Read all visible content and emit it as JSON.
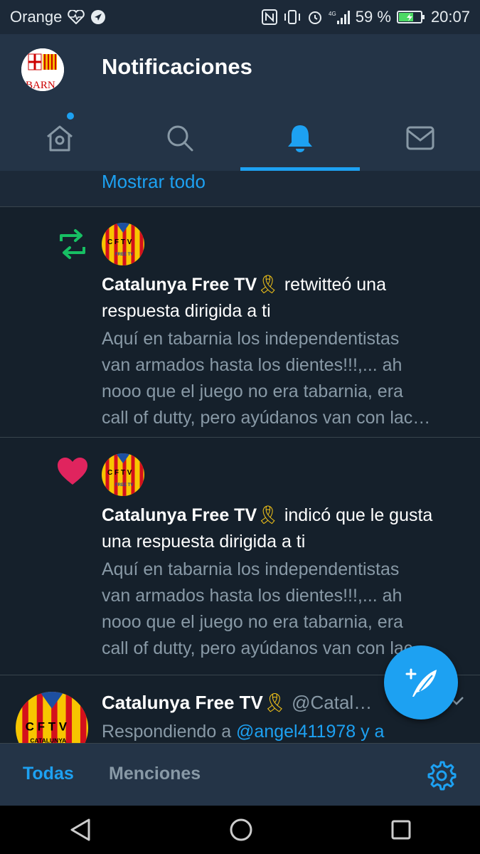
{
  "status": {
    "carrier": "Orange",
    "battery": "59 %",
    "time": "20:07"
  },
  "header": {
    "title": "Notificaciones",
    "avatar_text": "BARN"
  },
  "tabs": [
    {
      "name": "home",
      "active": false,
      "badge": true
    },
    {
      "name": "search",
      "active": false
    },
    {
      "name": "notifications",
      "active": true
    },
    {
      "name": "messages",
      "active": false
    }
  ],
  "show_all": "Mostrar todo",
  "notifications": [
    {
      "type": "retweet",
      "user": "Catalunya Free TV",
      "ribbon": "🎗",
      "action_line1": " retwitteó una",
      "action_line2": "respuesta dirigida a ti",
      "snippet": [
        "Aquí en tabarnia los independentistas",
        "van armados hasta los dientes!!!,... ah",
        "nooo que el juego no era tabarnia, era",
        "call of dutty, pero ayúdanos van con lac…"
      ],
      "avatar_text": "C F T V",
      "avatar_sub": "FREE TV"
    },
    {
      "type": "like",
      "user": "Catalunya Free TV",
      "ribbon": "🎗",
      "action_line1": " indicó que le gusta",
      "action_line2": "una respuesta dirigida a ti",
      "snippet": [
        "Aquí en tabarnia los independentistas",
        "van armados hasta los dientes!!!,... ah",
        "nooo que el juego no era tabarnia, era",
        "call of dutty, pero ayúdanos van con lac…"
      ],
      "avatar_text": "C F T V",
      "avatar_sub": "FREE TV"
    }
  ],
  "tweet": {
    "user": "Catalunya Free TV",
    "ribbon": "🎗",
    "handle": "@Catal…",
    "reply_prefix": "Respondiendo a ",
    "reply_link": "@angel411978 y a",
    "avatar_text": "C F T V",
    "avatar_sub": "CATALUNYA"
  },
  "filters": {
    "all": "Todas",
    "mentions": "Menciones"
  },
  "colors": {
    "accent": "#1da1f2",
    "retweet": "#17bf63",
    "like": "#e0245e"
  }
}
